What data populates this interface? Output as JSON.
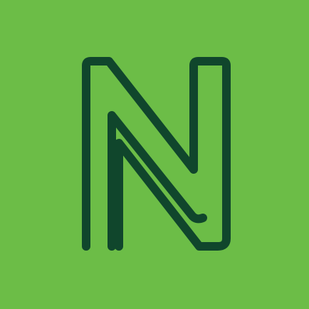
{
  "icon": {
    "name": "N-logo-icon",
    "letter": "N",
    "colors": {
      "background": "#6cbd47",
      "stroke": "#10462c"
    }
  }
}
